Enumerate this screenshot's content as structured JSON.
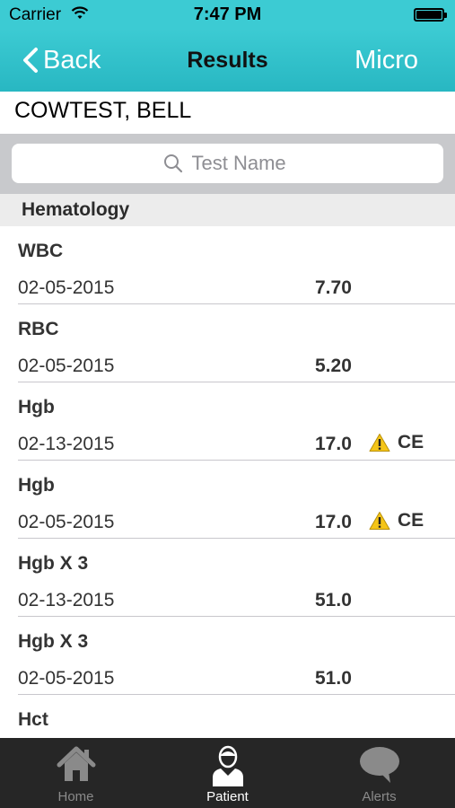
{
  "status_bar": {
    "carrier": "Carrier",
    "time": "7:47 PM"
  },
  "nav": {
    "back_label": "Back",
    "title": "Results",
    "right_label": "Micro"
  },
  "patient": {
    "name": "COWTEST, BELL"
  },
  "search": {
    "placeholder": "Test Name"
  },
  "section": {
    "title": "Hematology"
  },
  "results": [
    {
      "name": "WBC",
      "date": "02-05-2015",
      "value": "7.70",
      "flag": ""
    },
    {
      "name": "RBC",
      "date": "02-05-2015",
      "value": "5.20",
      "flag": ""
    },
    {
      "name": "Hgb",
      "date": "02-13-2015",
      "value": "17.0",
      "flag": "CE"
    },
    {
      "name": "Hgb",
      "date": "02-05-2015",
      "value": "17.0",
      "flag": "CE"
    },
    {
      "name": "Hgb X 3",
      "date": "02-13-2015",
      "value": "51.0",
      "flag": ""
    },
    {
      "name": "Hgb X 3",
      "date": "02-05-2015",
      "value": "51.0",
      "flag": ""
    },
    {
      "name": "Hct",
      "date": "",
      "value": "",
      "flag": ""
    }
  ],
  "tabs": [
    {
      "label": "Home",
      "icon": "home-icon",
      "active": false
    },
    {
      "label": "Patient",
      "icon": "patient-icon",
      "active": true
    },
    {
      "label": "Alerts",
      "icon": "speech-bubble-icon",
      "active": false
    }
  ],
  "colors": {
    "accent": "#3ccbd3",
    "tab_bar": "#262626",
    "warning": "#f5c518"
  }
}
